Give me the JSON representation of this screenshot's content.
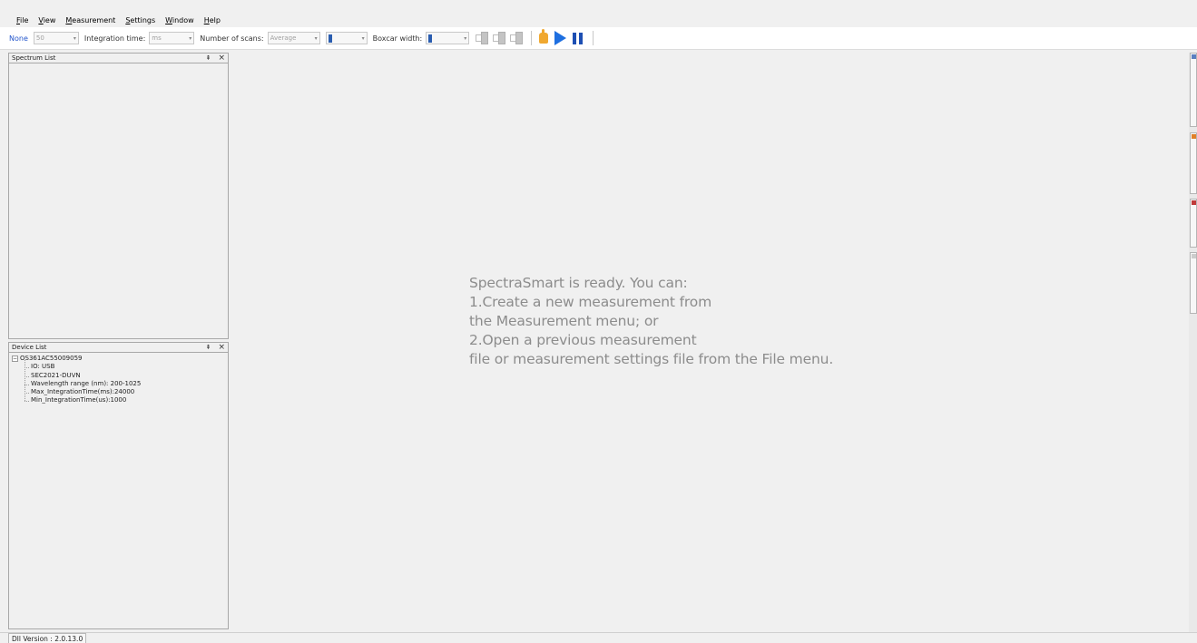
{
  "menu": {
    "items": [
      "File",
      "View",
      "Measurement",
      "Settings",
      "Window",
      "Help"
    ]
  },
  "toolbar": {
    "device_label": "None",
    "device_value": "50",
    "integration_label": "Integration time:",
    "integration_unit": "ms",
    "scans_label": "Number of scans:",
    "scans_mode": "Average",
    "boxcar_label": "Boxcar width:"
  },
  "spectrum_panel": {
    "title": "Spectrum List"
  },
  "device_panel": {
    "title": "Device List",
    "root": "OS361AC55009059",
    "items": [
      "IO: USB",
      "SEC2021-DUVN",
      "Wavelength range (nm): 200-1025",
      "Max_IntegrationTime(ms):24000",
      "Min_IntegrationTime(us):1000"
    ]
  },
  "welcome": {
    "lines": [
      "SpectraSmart is ready. You can:",
      "1.Create a new measurement from",
      "the Measurement menu; or",
      "2.Open a previous measurement",
      "file or measurement settings file from the File menu."
    ]
  },
  "status": {
    "dll_version": "Dll Version : 2.0.13.0"
  },
  "icons": {
    "tile_icons": [
      "tile-horizontal-icon",
      "tile-vertical-icon",
      "cascade-icon"
    ],
    "hand_icon": "hand-icon",
    "play_icon": "play-icon",
    "pause_icon": "pause-icon",
    "pin_icon": "pin-icon",
    "close_icon": "close-icon"
  },
  "colors": {
    "accent_blue": "#1e6fe0",
    "pause_blue": "#1d4fb3",
    "label_blue": "#2255cc",
    "welcome_text": "#8c8c8c",
    "hand_orange": "#f0a830"
  }
}
